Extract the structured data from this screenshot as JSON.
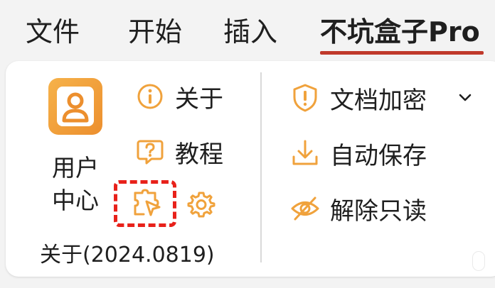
{
  "tabs": [
    {
      "label": "文件"
    },
    {
      "label": "开始"
    },
    {
      "label": "插入"
    },
    {
      "label": "不坑盒子Pro",
      "active": true
    }
  ],
  "ribbon": {
    "user_center_label": "用户\n中心",
    "about_label": "关于",
    "tutorial_label": "教程",
    "group_label": "关于(2024.0819)",
    "doc_encrypt_label": "文档加密",
    "auto_save_label": "自动保存",
    "remove_readonly_label": "解除只读"
  },
  "colors": {
    "accent_orange": "#f0a23c",
    "tab_underline": "#c0392b",
    "selection_dashed": "#e8211a"
  },
  "icons": {
    "user_center": "user-profile-icon",
    "about": "info-icon",
    "tutorial": "help-bubble-icon",
    "plugin": "plugin-cursor-icon",
    "settings": "gear-icon",
    "doc_encrypt": "shield-alert-icon",
    "auto_save": "download-icon",
    "remove_readonly": "eye-off-icon",
    "dropdown": "chevron-down-icon"
  }
}
